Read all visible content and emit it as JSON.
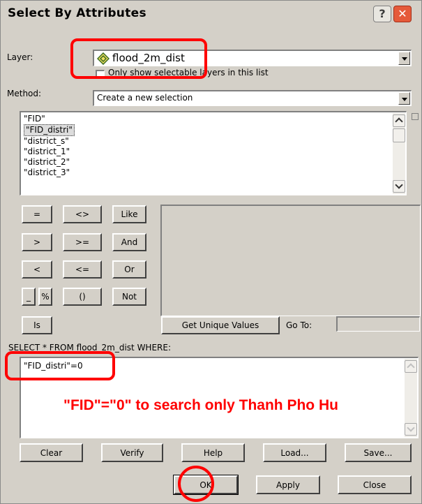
{
  "window": {
    "title": "Select By Attributes",
    "help_glyph": "?",
    "close_glyph": "✕"
  },
  "layer": {
    "label": "Layer:",
    "value": "flood_2m_dist",
    "icon": "layer-diamond-icon",
    "selectable_only_label": "Only show selectable layers in this list"
  },
  "method": {
    "label": "Method:",
    "value": "Create a new selection"
  },
  "fields": [
    "\"FID\"",
    "\"FID_distri\"",
    "\"district_s\"",
    "\"district_1\"",
    "\"district_2\"",
    "\"district_3\""
  ],
  "selected_field_index": 1,
  "operators": {
    "eq": "=",
    "ne": "<>",
    "like": "Like",
    "gt": ">",
    "ge": ">=",
    "and": "And",
    "lt": "<",
    "le": "<=",
    "or": "Or",
    "wild1": "_",
    "wild2": "%",
    "paren": "()",
    "not": "Not",
    "is": "Is"
  },
  "unique": {
    "button": "Get Unique Values",
    "goto_label": "Go To:"
  },
  "where_label": "SELECT * FROM flood_2m_dist WHERE:",
  "expression": "\"FID_distri\"=0",
  "annotation": "\"FID\"=\"0\" to search only Thanh Pho Hu",
  "buttons": {
    "clear": "Clear",
    "verify": "Verify",
    "help": "Help",
    "load": "Load...",
    "save": "Save...",
    "ok": "OK",
    "apply": "Apply",
    "close": "Close"
  },
  "colors": {
    "highlight": "#ff0000",
    "dialog_bg": "#d4d0c8"
  }
}
